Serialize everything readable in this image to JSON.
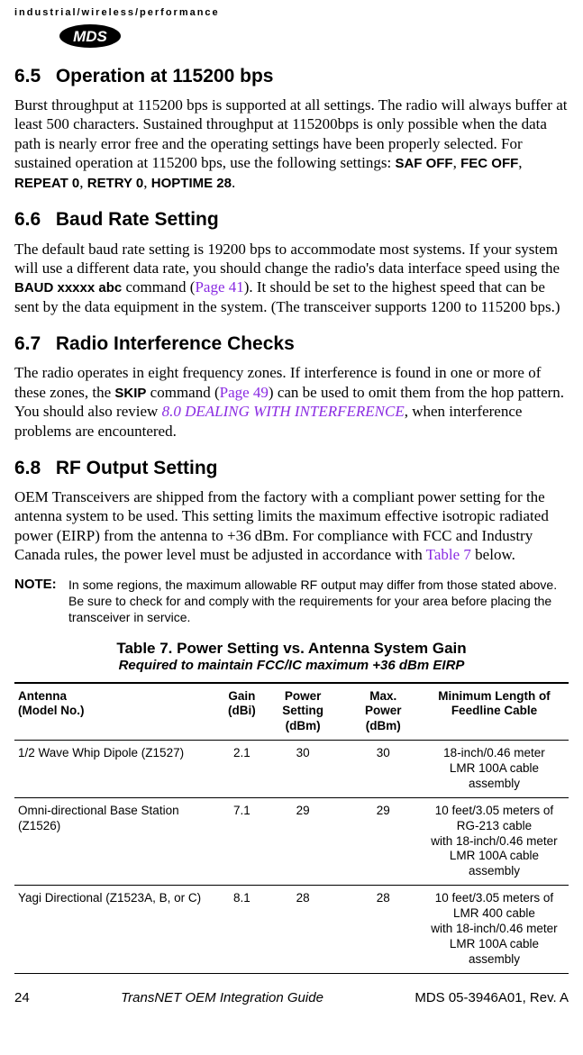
{
  "header": {
    "tagline": "industrial/wireless/performance",
    "logo_text": "MDS"
  },
  "sections": {
    "s65": {
      "num": "6.5",
      "title": "Operation at 115200 bps",
      "body_pre": "Burst throughput at 115200 bps is supported at all settings. The radio will always buffer at least 500 characters. Sustained throughput at 115200bps is only possible when the data path is nearly error free and the operating settings have been properly selected. For sustained operation at 115200 bps, use the following settings: ",
      "cmds": [
        "SAF OFF",
        "FEC OFF",
        "REPEAT 0",
        "RETRY 0",
        "HOPTIME 28"
      ]
    },
    "s66": {
      "num": "6.6",
      "title": "Baud Rate Setting",
      "body_a": "The default baud rate setting is 19200 bps to accommodate most systems. If your system will use a different data rate, you should change the radio's data interface speed using the ",
      "cmd": "BAUD xxxxx abc",
      "body_b": " command (",
      "link": "Page 41",
      "body_c": "). It should be set to the highest speed that can be sent by the data equipment in the system. (The transceiver supports 1200 to 115200 bps.)"
    },
    "s67": {
      "num": "6.7",
      "title": "Radio Interference Checks",
      "body_a": "The radio operates in eight frequency zones. If interference is found in one or more of these zones, the ",
      "cmd": "SKIP",
      "body_b": " command (",
      "link1": "Page 49",
      "body_c": ") can be used to omit them from the hop pattern. You should also review ",
      "link2": "8.0 DEALING WITH INTERFERENCE",
      "body_d": ", when interference problems are encountered."
    },
    "s68": {
      "num": "6.8",
      "title": "RF Output Setting",
      "body_a": "OEM Transceivers are shipped from the factory with a compliant power setting for the antenna system to be used. This setting limits the maximum effective isotropic radiated power (EIRP) from the antenna to +36 dBm. For compliance with FCC and Industry Canada rules, the power level must be adjusted in accordance with ",
      "link": "Table 7",
      "body_b": " below."
    }
  },
  "note": {
    "label": "NOTE:",
    "text": "In some regions, the maximum allowable RF output may differ from those stated above. Be sure to check for and comply with the requirements for your area before placing the transceiver in service."
  },
  "table7": {
    "title": "Table 7. Power Setting vs. Antenna System Gain",
    "subtitle": "Required to maintain FCC/IC maximum +36 dBm EIRP",
    "headers": {
      "c1a": "Antenna",
      "c1b": "(Model No.)",
      "c2a": "Gain",
      "c2b": "(dBi)",
      "c3a": "Power Setting",
      "c3b": "(dBm)",
      "c4a": "Max. Power",
      "c4b": "(dBm)",
      "c5a": "Minimum Length of",
      "c5b": "Feedline Cable"
    },
    "rows": [
      {
        "c1": "1/2 Wave Whip Dipole (Z1527)",
        "c2": "2.1",
        "c3": "30",
        "c4": "30",
        "c5a": "18-inch/0.46 meter",
        "c5b": "LMR 100A cable assembly"
      },
      {
        "c1": "Omni-directional Base Station (Z1526)",
        "c2": "7.1",
        "c3": "29",
        "c4": "29",
        "c5a": "10 feet/3.05 meters of",
        "c5b": "RG-213 cable",
        "c5c": "with 18-inch/0.46 meter",
        "c5d": "LMR 100A cable assembly"
      },
      {
        "c1": "Yagi Directional (Z1523A, B, or C)",
        "c2": "8.1",
        "c3": "28",
        "c4": "28",
        "c5a": "10 feet/3.05 meters of",
        "c5b": "LMR 400 cable",
        "c5c": "with 18-inch/0.46 meter",
        "c5d": "LMR 100A cable assembly"
      }
    ]
  },
  "footer": {
    "page": "24",
    "center": "TransNET OEM Integration Guide",
    "right": "MDS 05-3946A01, Rev.  A"
  }
}
